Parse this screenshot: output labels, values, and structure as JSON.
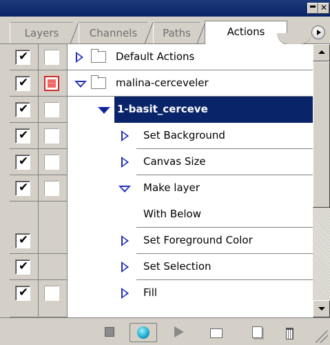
{
  "panel": {
    "tabs": [
      {
        "label": "Layers"
      },
      {
        "label": "Channels"
      },
      {
        "label": "Paths"
      },
      {
        "label": "Actions"
      }
    ],
    "active_tab": "Actions"
  },
  "actions": [
    {
      "label": "Default Actions",
      "checked": true,
      "dialog": false,
      "expanded": false,
      "kind": "set"
    },
    {
      "label": "malina-cerceveler",
      "checked": true,
      "dialog": true,
      "expanded": true,
      "kind": "set"
    },
    {
      "label": "1-basit_cerceve",
      "checked": true,
      "dialog": false,
      "expanded": true,
      "kind": "action",
      "selected": true
    },
    {
      "label": "Set Background",
      "checked": true,
      "dialog": false,
      "expanded": false,
      "kind": "command"
    },
    {
      "label": "Canvas Size",
      "checked": true,
      "dialog": false,
      "expanded": false,
      "kind": "command"
    },
    {
      "label": "Make layer",
      "checked": true,
      "dialog": false,
      "expanded": true,
      "kind": "command"
    },
    {
      "label": "With Below",
      "kind": "detail"
    },
    {
      "label": "Set Foreground Color",
      "checked": true,
      "kind": "command"
    },
    {
      "label": "Set Selection",
      "checked": true,
      "kind": "command"
    },
    {
      "label": "Fill",
      "checked": true,
      "dialog": false,
      "kind": "command"
    }
  ],
  "checkmark": "✔",
  "toolbar": {
    "icons": [
      "stop-icon",
      "record-icon",
      "play-icon",
      "new-set-icon",
      "new-action-icon",
      "trash-icon"
    ]
  }
}
